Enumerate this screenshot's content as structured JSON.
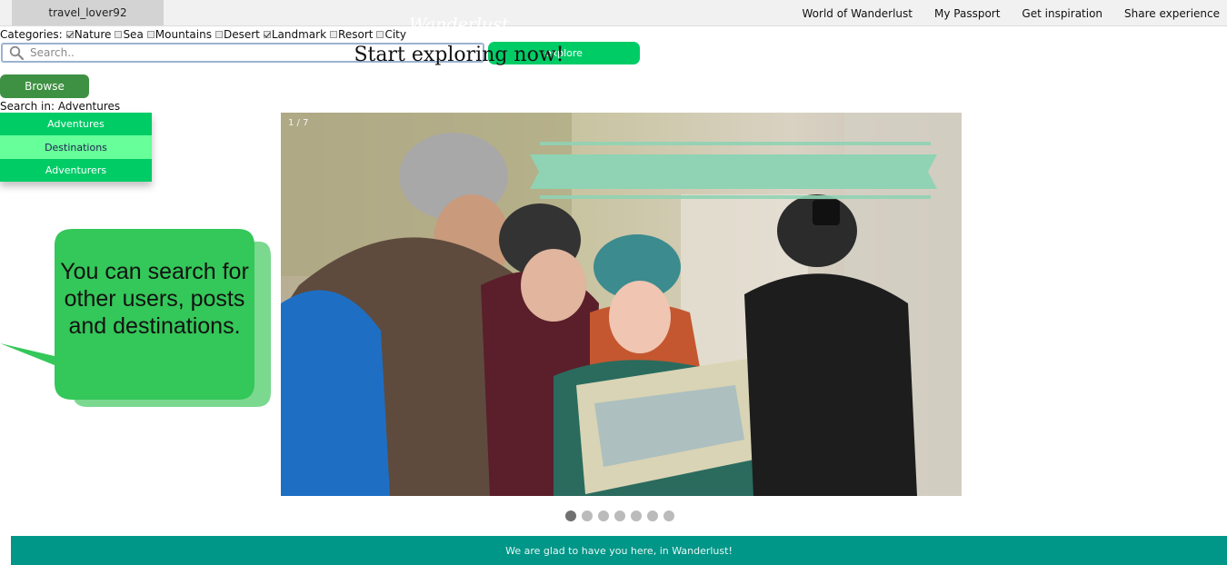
{
  "header": {
    "username": "travel_lover92",
    "nav": [
      "World of Wanderlust",
      "My Passport",
      "Get inspiration",
      "Share experience"
    ]
  },
  "categories": {
    "label": "Categories:",
    "items": [
      {
        "label": "Nature",
        "checked": true
      },
      {
        "label": "Sea",
        "checked": false
      },
      {
        "label": "Mountains",
        "checked": false
      },
      {
        "label": "Desert",
        "checked": false
      },
      {
        "label": "Landmark",
        "checked": true
      },
      {
        "label": "Resort",
        "checked": false
      },
      {
        "label": "City",
        "checked": false
      }
    ]
  },
  "search": {
    "placeholder": "Search..",
    "value": "",
    "button": "explore",
    "icon": "search-icon"
  },
  "browse": {
    "button": "Browse",
    "search_in": "Search in: Adventures",
    "options": [
      "Adventures",
      "Destinations",
      "Adventurers"
    ],
    "hovered": "Destinations"
  },
  "tooltip": {
    "text": "You can search for other users, posts and destinations."
  },
  "carousel": {
    "counter": "1 / 7",
    "banner_script": "Wanderlust",
    "banner_text": "Start exploring now!",
    "total": 7,
    "active": 1
  },
  "footer": {
    "text": "We are glad to have you here, in Wanderlust!"
  },
  "colors": {
    "accent_green": "#00cc66",
    "browse_green": "#3e9142",
    "footer_teal": "#009688",
    "bubble_green": "#33cc55"
  }
}
